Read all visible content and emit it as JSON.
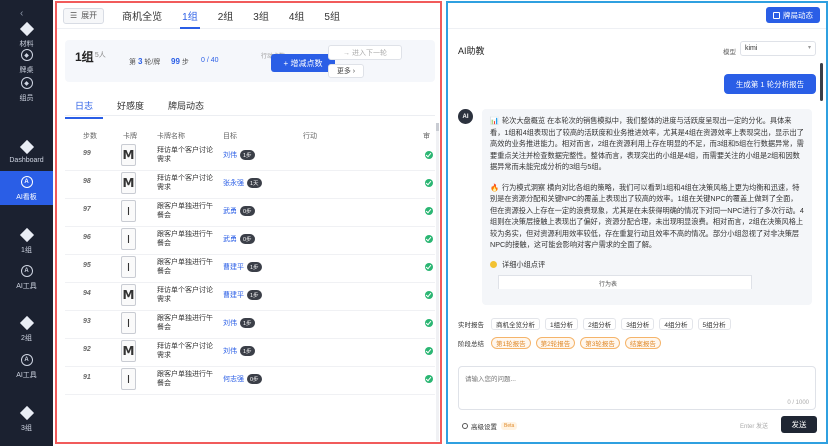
{
  "sidebar": {
    "items": [
      {
        "label": "材料"
      },
      {
        "label": "牌桌"
      },
      {
        "label": "组员"
      },
      {
        "label": "Dashboard"
      },
      {
        "label": "AI看板"
      },
      {
        "label": "1组"
      },
      {
        "label": "AI工具"
      },
      {
        "label": "2组"
      },
      {
        "label": "AI工具"
      },
      {
        "label": "3组"
      }
    ]
  },
  "left": {
    "expand_label": "展开",
    "tabs": [
      "商机全览",
      "1组",
      "2组",
      "3组",
      "4组",
      "5组"
    ],
    "active_tab": "1组",
    "group": {
      "name": "1组",
      "members": "/ 5人",
      "round_prefix": "第",
      "round_value": "3",
      "round_suffix": "轮/牌",
      "steps_value": "99",
      "steps_suffix": "步",
      "action_value": "0 / 40",
      "action_label": "行动点数",
      "add_button": "+ 增减点数",
      "next_button": "→ 进入下一轮",
      "more_button": "更多 ›"
    },
    "sub_tabs": [
      "日志",
      "好感度",
      "牌局动态"
    ],
    "columns": [
      "步数",
      "卡牌",
      "卡牌名称",
      "目标",
      "行动",
      "审"
    ],
    "rows": [
      {
        "step": "99",
        "card": "M",
        "name": "拜访单个客户讨论需求",
        "target": "刘伟",
        "tag": "1步"
      },
      {
        "step": "98",
        "card": "M",
        "name": "拜访单个客户讨论需求",
        "target": "张永强",
        "tag": "1天"
      },
      {
        "step": "97",
        "card": "I",
        "name": "跟客户单独进行午餐会",
        "target": "武勇",
        "tag": "0步"
      },
      {
        "step": "96",
        "card": "I",
        "name": "跟客户单独进行午餐会",
        "target": "武勇",
        "tag": "0步"
      },
      {
        "step": "95",
        "card": "I",
        "name": "跟客户单独进行午餐会",
        "target": "曹建平",
        "tag": "1步"
      },
      {
        "step": "94",
        "card": "M",
        "name": "拜访单个客户讨论需求",
        "target": "曹建平",
        "tag": "1步"
      },
      {
        "step": "93",
        "card": "I",
        "name": "跟客户单独进行午餐会",
        "target": "刘伟",
        "tag": "1步"
      },
      {
        "step": "92",
        "card": "M",
        "name": "拜访单个客户讨论需求",
        "target": "刘伟",
        "tag": "1步"
      },
      {
        "step": "91",
        "card": "I",
        "name": "跟客户单独进行午餐会",
        "target": "何志强",
        "tag": "0步"
      }
    ]
  },
  "right": {
    "dyn_button": "牌局动态",
    "title": "AI助教",
    "model_label": "模型",
    "model_value": "kimi",
    "user_message": "生成第 1 轮分析报告",
    "ai_avatar": "AI",
    "paragraph1_icon": "📊",
    "paragraph1": "轮次大盘概览 在本轮次的销售模拟中，我们整体的进度与活跃度呈现出一定的分化。具体来看，1组和4组表现出了较高的活跃度和业务推进效率，尤其是4组在资源效率上表现突出，显示出了高效的业务推进能力。相对而言，2组在资源利用上存在明显的不足，而3组和5组在行数据异常，需要重点关注并检查数据完整性。整体而言，表现突出的小组是4组，而需要关注的小组是2组和因数据异常而未能完成分析的3组与5组。",
    "paragraph2_icon": "🔥",
    "paragraph2": "行为模式洞察 横向对比各组的策略，我们可以看到1组和4组在决策风格上更为均衡和迅速，特别是在资源分配和关键NPC的覆盖上表现出了较高的效率。1组在关键NPC的覆盖上做到了全面，但在资源投入上存在一定的浪费现象，尤其是在未获得明确的情况下对同一NPC进行了多次行动。4组则在决策层接触上表现出了偏好，资源分配合理，未出现明显浪费。相对而言，2组在决策风格上较为务实，但对资源利用效率较低，存在重复行动且效率不高的情况。部分小组忽视了对非决策层NPC的接触，这可能会影响对客户需求的全面了解。",
    "detail_heading": "详细小组点评",
    "table_header_partial": "行为表",
    "realtime_label": "实时报告",
    "realtime_chips": [
      "商机全览分析",
      "1组分析",
      "2组分析",
      "3组分析",
      "4组分析",
      "5组分析"
    ],
    "stage_label": "阶段总结",
    "stage_chips": [
      "第1轮报告",
      "第2轮报告",
      "第3轮报告",
      "结案报告"
    ],
    "input_placeholder": "请输入您的问题...",
    "counter": "0 / 1000",
    "advanced_label": "高级设置",
    "beta_label": "Beta",
    "enter_hint": "Enter 发送",
    "send_label": "发送"
  },
  "colors": {
    "accent": "#2a5ee6",
    "sidebar_bg": "#1b2130",
    "left_border": "#f15b5b",
    "right_border": "#2fa0e0",
    "ok_green": "#2bb673"
  }
}
